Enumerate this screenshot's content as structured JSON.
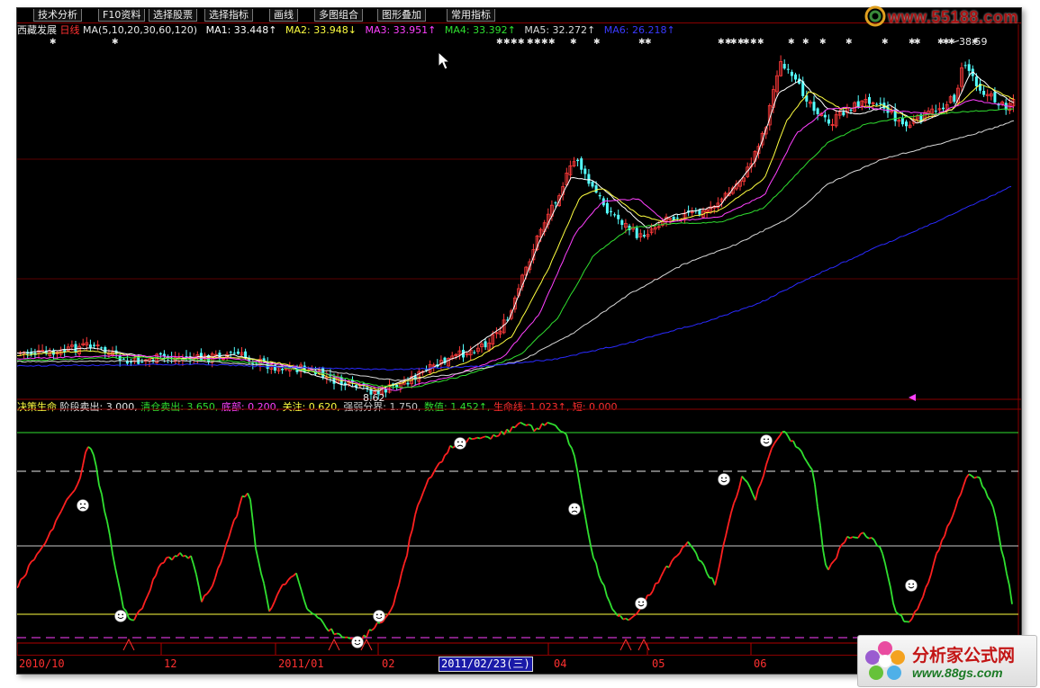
{
  "menubar": {
    "items": [
      "技术分析",
      "F10资料",
      "选择股票",
      "选择指标",
      "画线",
      "多图组合",
      "图形叠加",
      "常用指标"
    ]
  },
  "upper": {
    "stock_name": "西藏发展",
    "period": "日线",
    "ma_params": "MA(5,10,20,30,60,120)",
    "ma1": "MA1: 33.448↑",
    "ma2": "MA2: 33.948↓",
    "ma3": "MA3: 33.951↑",
    "ma4": "MA4: 33.392↑",
    "ma5": "MA5: 32.272↑",
    "ma6": "MA6: 26.218↑",
    "high_label": "38.59",
    "low_label": "8.62",
    "colors": {
      "ma1": "#ffffff",
      "ma2": "#ffff40",
      "ma3": "#ff40ff",
      "ma4": "#30e030",
      "ma5": "#d8d8d8",
      "ma6": "#2a2aff"
    }
  },
  "lower": {
    "indicator_name": "决策生命",
    "stage_sell": "阶段卖出: 3.000,",
    "clear_sell": "清仓卖出: 3.650,",
    "bottom": "底部: 0.200,",
    "attention": "关注: 0.620,",
    "strong_weak": "强弱分界: 1.750,",
    "value": "数值: 1.452↑,",
    "lifeline": "生命线: 1.023↑,",
    "short": "短: 0.000",
    "colors": {
      "up": "#ff2020",
      "down": "#30e030",
      "smile": "#ffffff"
    }
  },
  "date_axis": {
    "labels": [
      "2010/10",
      "12",
      "2011/01",
      "02",
      "04",
      "05",
      "06"
    ],
    "cursor_date": "2011/02/23(三)"
  },
  "watermark_top": "www.55188.com",
  "watermark_bottom": {
    "name": "分析家公式网",
    "url": "www.88gs.com"
  }
}
